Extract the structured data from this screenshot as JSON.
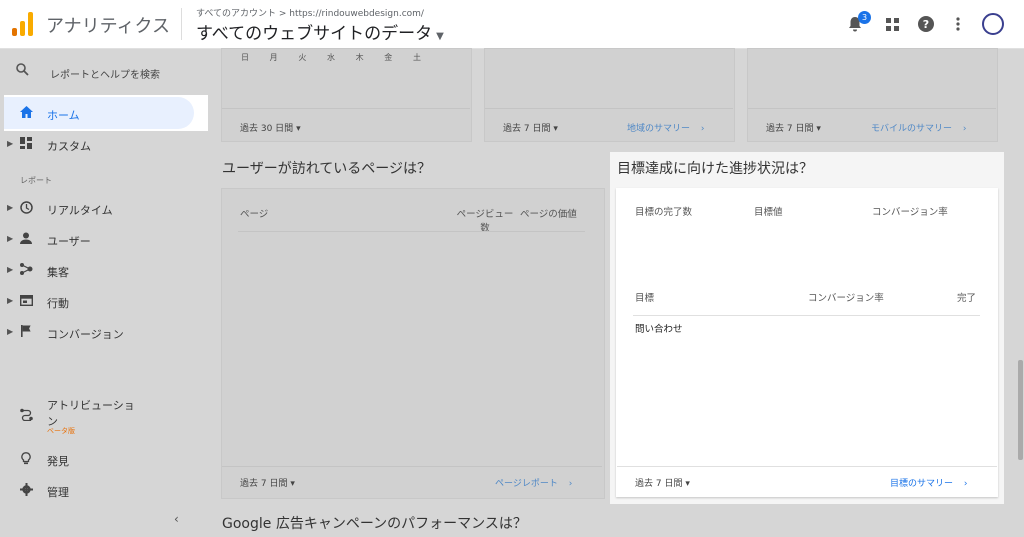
{
  "header": {
    "app_title": "アナリティクス",
    "account_path": "すべてのアカウント > https://rindouwebdesign.com/",
    "view_name": "すべてのウェブサイトのデータ",
    "notification_count": "3"
  },
  "sidebar": {
    "search_label": "レポートとヘルプを検索",
    "home": "ホーム",
    "custom": "カスタム",
    "section_reports": "レポート",
    "items": [
      "リアルタイム",
      "ユーザー",
      "集客",
      "行動",
      "コンバージョン"
    ],
    "attribution_line1": "アトリビューショ",
    "attribution_line2": "ン",
    "attribution_badge": "ベータ版",
    "discover": "発見",
    "admin": "管理"
  },
  "top_cards": {
    "weekdays": [
      "日",
      "月",
      "火",
      "水",
      "木",
      "金",
      "土"
    ],
    "card1_range": "過去 30 日間",
    "card2_range": "過去 7 日間",
    "card2_link": "地域のサマリー",
    "card3_range": "過去 7 日間",
    "card3_link": "モバイルのサマリー"
  },
  "pages_card": {
    "title": "ユーザーが訪れているページは？",
    "col_page": "ページ",
    "col_pageviews_line1": "ページビュー",
    "col_pageviews_line2": "数",
    "col_page_value": "ページの価値",
    "range": "過去 7 日間",
    "link": "ページレポート"
  },
  "goals_card": {
    "title": "目標達成に向けた進捗状況は？",
    "col_completions": "目標の完了数",
    "col_value": "目標値",
    "col_conv_rate": "コンバージョン率",
    "col_goal": "目標",
    "col_conv_rate2": "コンバージョン率",
    "col_complete": "完了",
    "goal_row": "問い合わせ",
    "range": "過去 7 日間",
    "link": "目標のサマリー"
  },
  "ads_section": {
    "title": "Google 広告キャンペーンのパフォーマンスは？"
  },
  "colors": {
    "accent": "#1a73e8",
    "link": "#4f88c6",
    "beta": "#e8710a",
    "logo_orange": "#f9ab00",
    "logo_dark": "#e37400"
  }
}
